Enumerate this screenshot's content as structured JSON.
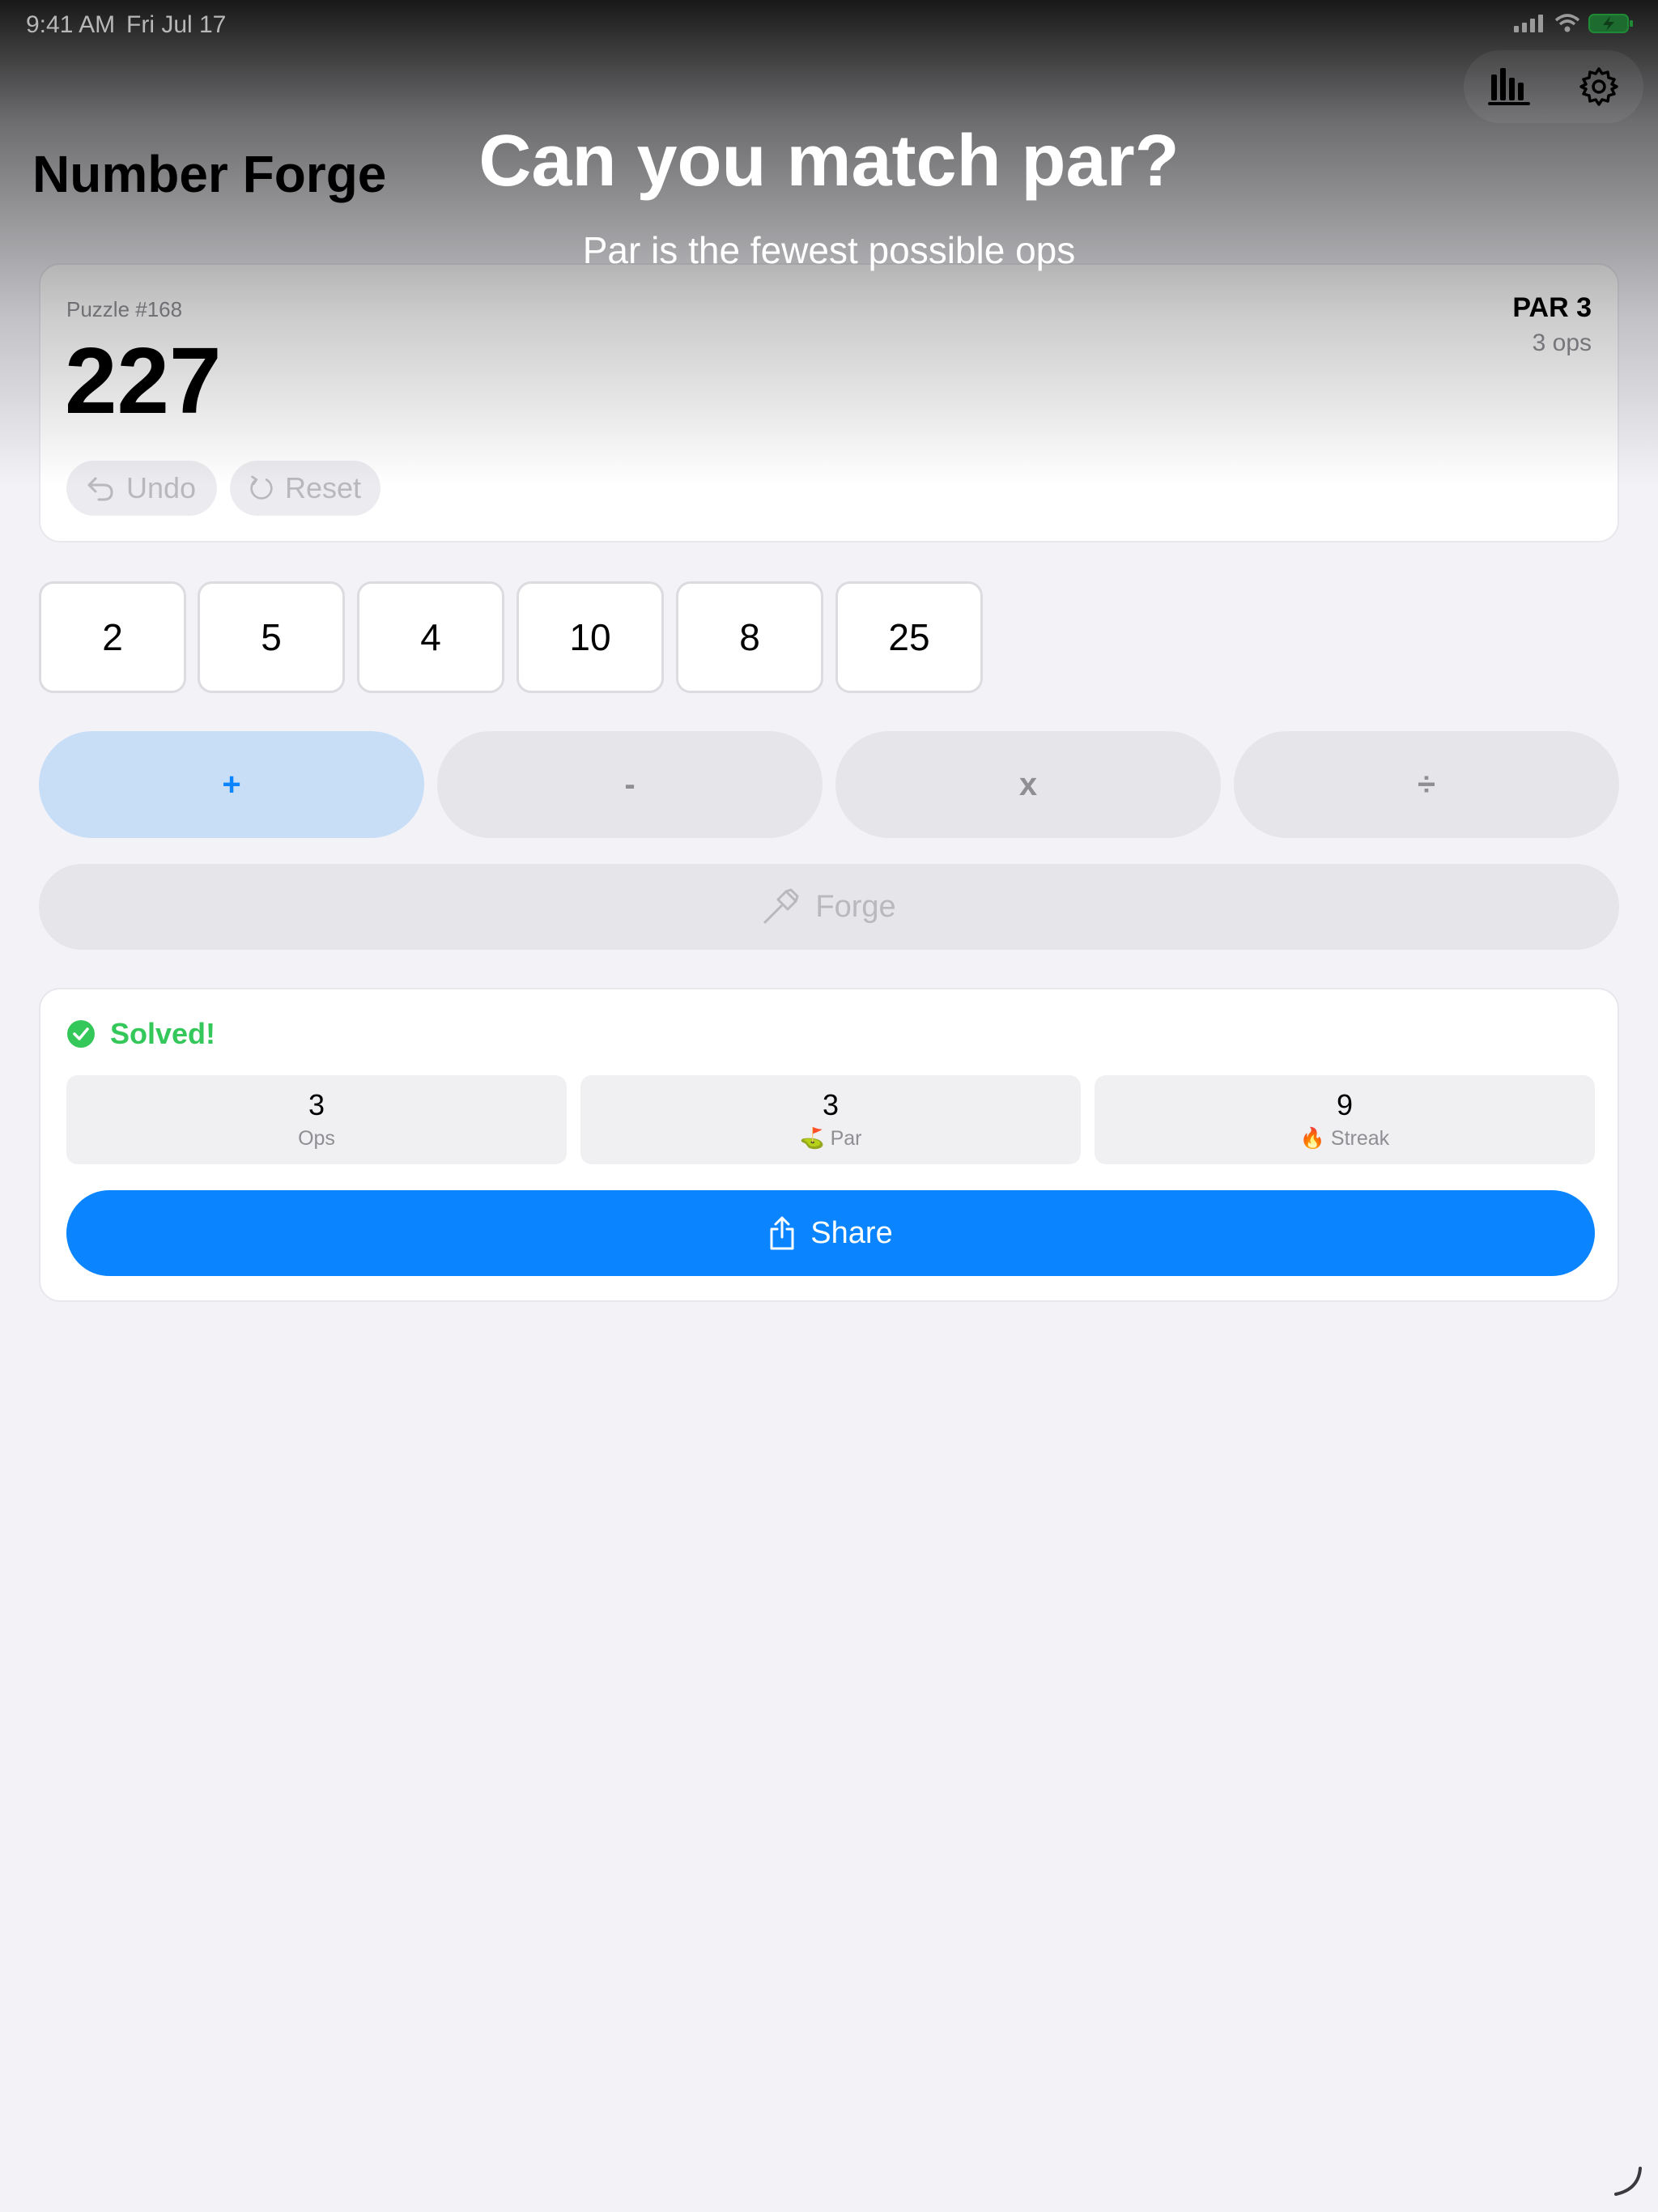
{
  "status_bar": {
    "time": "9:41 AM",
    "date": "Fri Jul 17"
  },
  "toolbar": {
    "stats_icon": "chart-bar-icon",
    "settings_icon": "gear-icon"
  },
  "app": {
    "title": "Number Forge"
  },
  "overlay": {
    "title": "Can you match par?",
    "subtitle": "Par is the fewest possible ops"
  },
  "puzzle": {
    "label": "Puzzle #168",
    "target": "227",
    "par_label": "PAR 3",
    "par_ops": "3 ops",
    "undo_label": "Undo",
    "reset_label": "Reset"
  },
  "tiles": [
    "2",
    "5",
    "4",
    "10",
    "8",
    "25"
  ],
  "operators": {
    "plus": "+",
    "minus": "-",
    "times": "x",
    "divide": "÷",
    "selected": "+"
  },
  "forge": {
    "label": "Forge"
  },
  "result": {
    "solved_label": "Solved!",
    "stats": [
      {
        "value": "3",
        "label": "Ops"
      },
      {
        "value": "3",
        "label": "⛳ Par"
      },
      {
        "value": "9",
        "label": "🔥 Streak"
      }
    ],
    "share_label": "Share"
  },
  "colors": {
    "accent": "#0a84ff",
    "success": "#34c759",
    "background": "#f2f2f7",
    "selected_operator_bg": "#c8def7"
  }
}
